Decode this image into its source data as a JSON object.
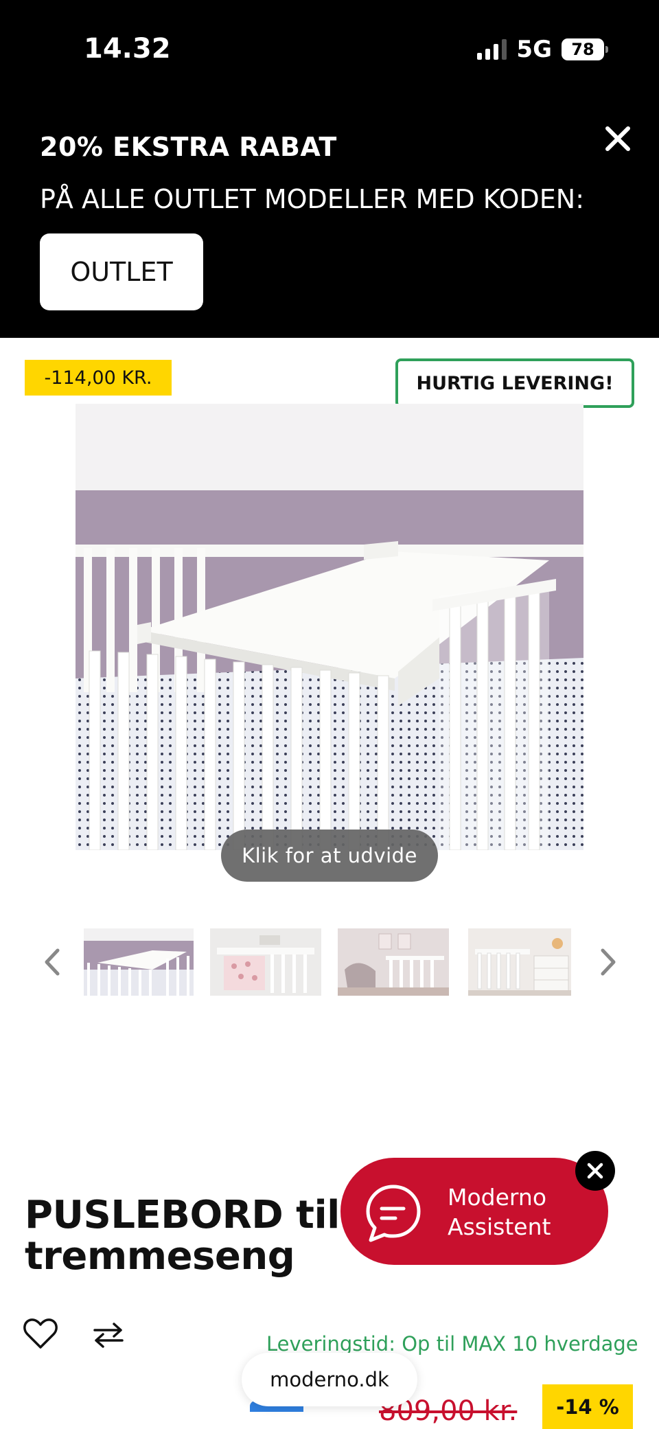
{
  "status_bar": {
    "time": "14.32",
    "network": "5G",
    "battery": "78"
  },
  "promo": {
    "title": "20% EKSTRA RABAT",
    "text": "PÅ ALLE OUTLET MODELLER MED KODEN:",
    "code": "OUTLET",
    "close_icon": "close-icon"
  },
  "badges": {
    "discount": "-114,00 KR.",
    "delivery": "HURTIG LEVERING!"
  },
  "gallery": {
    "expand_label": "Klik for at udvide",
    "thumbnail_count": 4,
    "prev_icon": "chevron-left-icon",
    "next_icon": "chevron-right-icon"
  },
  "product": {
    "title_line1": "PUSLEBORD til",
    "title_line2": "tremmeseng",
    "delivery_time": "Leveringstid: Op til MAX 10 hverdage",
    "old_price": "809,00 kr.",
    "discount_pct": "-14 %"
  },
  "chat": {
    "line1": "Moderno",
    "line2": "Assistent",
    "icon": "chat-bubble-icon"
  },
  "browser": {
    "url": "moderno.dk"
  },
  "colors": {
    "accent_red": "#c8102e",
    "badge_yellow": "#ffd600",
    "delivery_green": "#2fa05a"
  }
}
